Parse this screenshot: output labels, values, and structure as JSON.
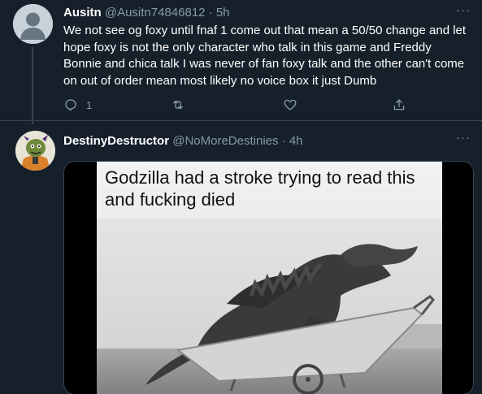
{
  "tweets": [
    {
      "name": "Ausitn",
      "handle": "@Ausitn74846812",
      "time": "5h",
      "text": "We not see og foxy until fnaf 1 come out that mean a 50/50 change and let hope foxy is not the only character who talk in this game and Freddy Bonnie and chica talk I was never of fan foxy talk and the other can't come on out of order mean most likely no voice box it just Dumb",
      "reply_count": "1",
      "more_icon": "more-icon"
    },
    {
      "name": "DestinyDestructor",
      "handle": "@NoMoreDestinies",
      "time": "4h",
      "more_icon": "more-icon",
      "media_caption": "Godzilla had a stroke trying to read this and fucking died"
    }
  ],
  "separator": "·",
  "colors": {
    "background": "#15202b",
    "secondary_text": "#8899a6",
    "border": "#38444d"
  }
}
